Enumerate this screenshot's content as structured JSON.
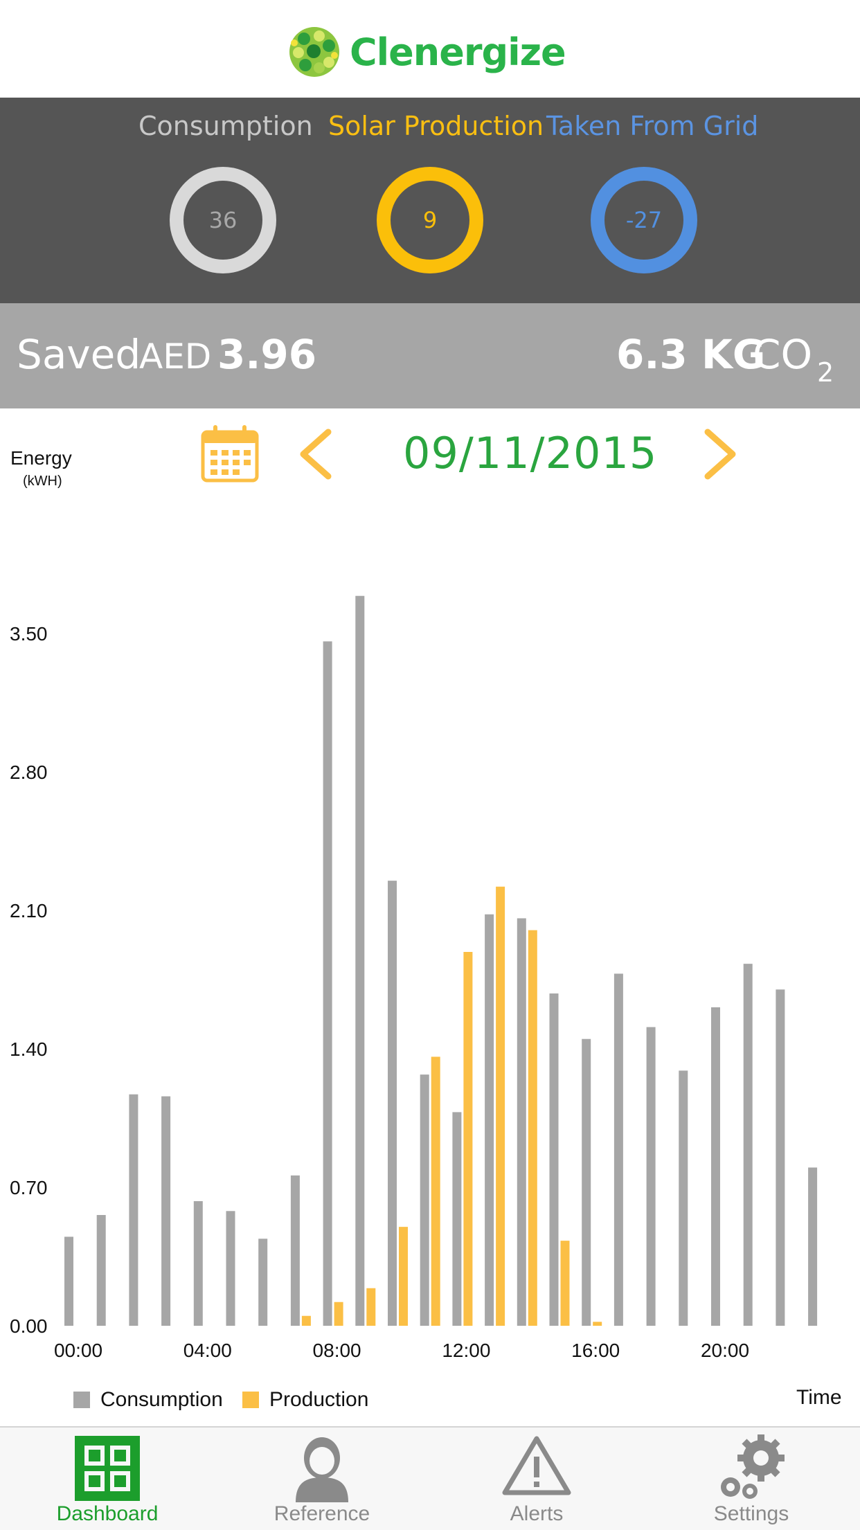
{
  "header": {
    "app_title": "Clenergize",
    "logo_icon": "leaf-sphere-logo"
  },
  "summary": {
    "consumption_label": "Consumption",
    "solar_label": "Solar Production",
    "grid_label": "Taken From Grid",
    "consumption_value": "36",
    "solar_value": "9",
    "grid_value": "-27",
    "colors": {
      "panel": "#555555",
      "consumption": "#d9d9d9",
      "solar": "#fbbf0a",
      "grid": "#5290e0"
    }
  },
  "savings": {
    "saved_prefix": "Saved",
    "currency": "AED",
    "saved_amount": "3.96",
    "co2_amount": "6.3 KG",
    "co2_unit": "CO",
    "co2_subscript": "2"
  },
  "date_nav": {
    "energy_label": "Energy",
    "energy_unit": "(kWH)",
    "date": "09/11/2015",
    "calendar_icon": "calendar-icon",
    "prev_icon": "chevron-left-icon",
    "next_icon": "chevron-right-icon"
  },
  "chart_data": {
    "type": "bar",
    "title": "",
    "xlabel": "Time",
    "ylabel": "Energy (kWH)",
    "ylim": [
      0,
      3.7
    ],
    "y_ticks": [
      "0.00",
      "0.70",
      "1.40",
      "2.10",
      "2.80",
      "3.50"
    ],
    "x_tick_labels": [
      "00:00",
      "04:00",
      "08:00",
      "12:00",
      "16:00",
      "20:00"
    ],
    "categories": [
      "00:00",
      "01:00",
      "02:00",
      "03:00",
      "04:00",
      "05:00",
      "06:00",
      "07:00",
      "08:00",
      "09:00",
      "10:00",
      "11:00",
      "12:00",
      "13:00",
      "14:00",
      "15:00",
      "16:00",
      "17:00",
      "18:00",
      "19:00",
      "20:00",
      "21:00",
      "22:00",
      "23:00"
    ],
    "series": [
      {
        "name": "Consumption",
        "color": "#a6a6a6",
        "values": [
          0.45,
          0.56,
          1.17,
          1.16,
          0.63,
          0.58,
          0.44,
          0.76,
          3.46,
          3.69,
          2.25,
          1.27,
          1.08,
          2.08,
          2.06,
          1.68,
          1.45,
          1.78,
          1.51,
          1.29,
          1.61,
          1.83,
          1.7,
          0.8
        ]
      },
      {
        "name": "Production",
        "color": "#fbbf45",
        "values": [
          0,
          0,
          0,
          0,
          0,
          0,
          0,
          0.05,
          0.12,
          0.19,
          0.5,
          1.36,
          1.89,
          2.22,
          2.0,
          0.43,
          0.02,
          0,
          0,
          0,
          0,
          0,
          0,
          0
        ]
      }
    ],
    "legend": "bottom-left",
    "grid": false
  },
  "tabs": [
    {
      "label": "Dashboard",
      "icon": "dashboard-grid-icon",
      "active": true
    },
    {
      "label": "Reference",
      "icon": "person-icon",
      "active": false
    },
    {
      "label": "Alerts",
      "icon": "warning-icon",
      "active": false
    },
    {
      "label": "Settings",
      "icon": "gear-icon",
      "active": false
    }
  ]
}
